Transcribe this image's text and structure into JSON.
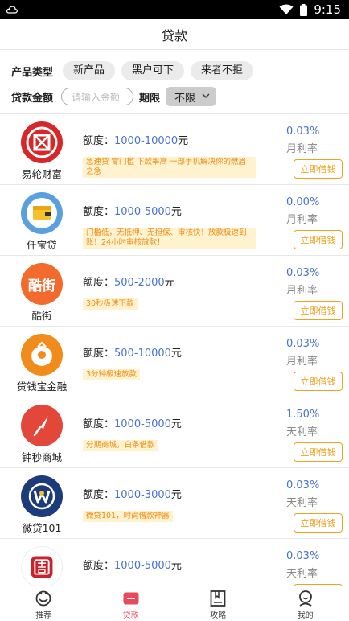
{
  "status": {
    "time": "9:15",
    "app_icon": "cloud-outline-icon",
    "wifi_icon": "wifi-icon",
    "battery_icon": "battery-icon"
  },
  "header": {
    "title": "贷款"
  },
  "filters": {
    "product_type_label": "产品类型",
    "product_types": [
      "新产品",
      "黑户可下",
      "来者不拒"
    ],
    "amount_label": "贷款金额",
    "amount_placeholder": "请输入金额",
    "period_label": "期限",
    "period_selected": "不限"
  },
  "list": {
    "amount_prefix": "额度：",
    "amount_suffix": "元",
    "apply_label": "立即借钱",
    "items": [
      {
        "name": "易轮财富",
        "min": "1000",
        "max": "10000",
        "tag": "急速贷 零门槛 下款率高 一部手机解决你的燃眉之急",
        "rate": "0.03%",
        "rate_label": "月利率",
        "logo_icon": "coin-logo-icon",
        "logo_color": "#d62828"
      },
      {
        "name": "仟宝贷",
        "min": "1000",
        "max": "5000",
        "tag": "门槛低，无抵押、无担保、审核快！放款极速到账！24小时审核放款！",
        "rate": "0.00%",
        "rate_label": "月利率",
        "logo_icon": "wallet-logo-icon",
        "logo_color": "#5aa0de"
      },
      {
        "name": "酷街",
        "min": "500",
        "max": "2000",
        "tag": "30秒极速下款",
        "rate": "0.03%",
        "rate_label": "月利率",
        "logo_icon": "kujie-logo-icon",
        "logo_color": "#f26b2c",
        "logo_text": "酷街"
      },
      {
        "name": "贷钱宝金融",
        "min": "500",
        "max": "10000",
        "tag": "3分钟极速放款",
        "rate": "0.03%",
        "rate_label": "月利率",
        "logo_icon": "money-bag-logo-icon",
        "logo_color": "#f08c1c"
      },
      {
        "name": "钟秒商城",
        "min": "1000",
        "max": "5000",
        "tag": "分期商城，白条借款",
        "rate": "1.50%",
        "rate_label": "天利率",
        "logo_icon": "clock-hand-logo-icon",
        "logo_color": "#e2473a"
      },
      {
        "name": "微贷101",
        "min": "1000",
        "max": "3000",
        "tag": "微贷101，时尚借款神器",
        "rate": "0.03%",
        "rate_label": "天利率",
        "logo_icon": "w-coin-logo-icon",
        "logo_color": "#1d3a7a"
      },
      {
        "name": "",
        "min": "1000",
        "max": "5000",
        "tag": "",
        "rate": "0.03%",
        "rate_label": "天利率",
        "logo_icon": "ji-logo-icon",
        "logo_color": "#c8242e"
      }
    ]
  },
  "tabbar": {
    "active_color": "#e94a5b",
    "items": [
      {
        "label": "推荐",
        "icon": "recommend-icon"
      },
      {
        "label": "贷款",
        "icon": "loan-card-icon"
      },
      {
        "label": "攻略",
        "icon": "book-icon"
      },
      {
        "label": "我的",
        "icon": "profile-icon"
      }
    ]
  }
}
